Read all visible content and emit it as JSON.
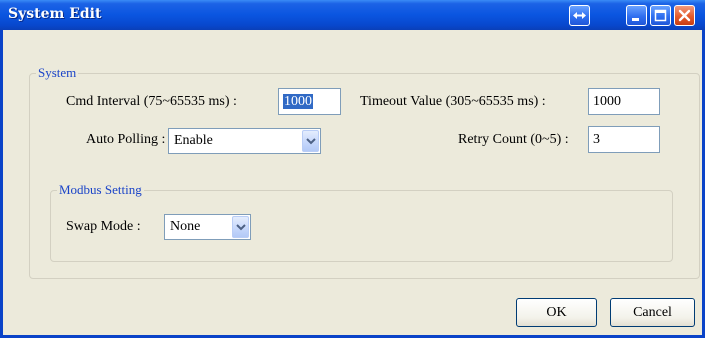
{
  "window": {
    "title": "System Edit"
  },
  "system_group": {
    "legend": "System",
    "cmd_interval_label": "Cmd Interval (75~65535 ms) :",
    "cmd_interval_value": "1000",
    "timeout_label": "Timeout Value (305~65535 ms) :",
    "timeout_value": "1000",
    "auto_polling_label": "Auto Polling :",
    "auto_polling_value": "Enable",
    "retry_label": "Retry Count (0~5) :",
    "retry_value": "3"
  },
  "modbus_group": {
    "legend": "Modbus Setting",
    "swap_label": "Swap Mode :",
    "swap_value": "None"
  },
  "buttons": {
    "ok": "OK",
    "cancel": "Cancel"
  },
  "icons": {
    "restore": "double-arrow-icon",
    "minimize": "minimize-icon",
    "maximize": "maximize-icon",
    "close": "close-icon"
  }
}
